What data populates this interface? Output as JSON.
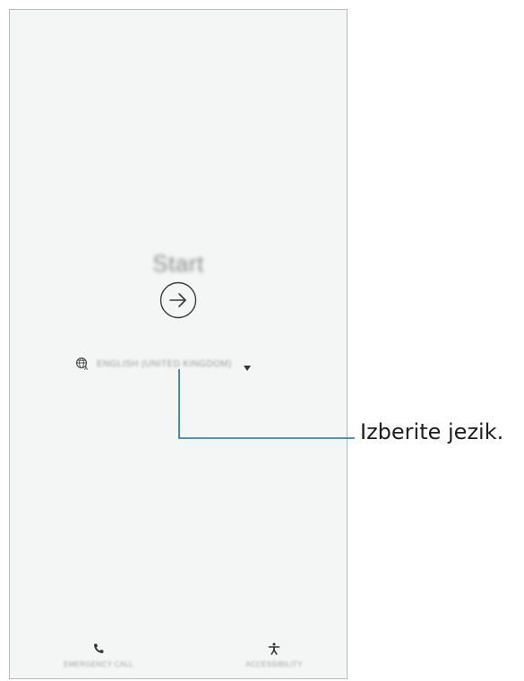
{
  "screen": {
    "title": "Start",
    "next_button_icon": "arrow-right-circle-icon",
    "language": {
      "icon": "globe-icon",
      "value": "ENGLISH (UNITED KINGDOM)",
      "dropdown_icon": "triangle-down-icon"
    },
    "bottom_actions": [
      {
        "label": "EMERGENCY CALL",
        "icon": "phone-icon"
      },
      {
        "label": "ACCESSIBILITY",
        "icon": "accessibility-icon"
      }
    ]
  },
  "callout": {
    "text": "Izberite jezik.",
    "line_color": "#1e6fa5"
  },
  "colors": {
    "screen_bg": "#f4f5f5",
    "border": "#b9b9b9",
    "icon": "#333333"
  }
}
